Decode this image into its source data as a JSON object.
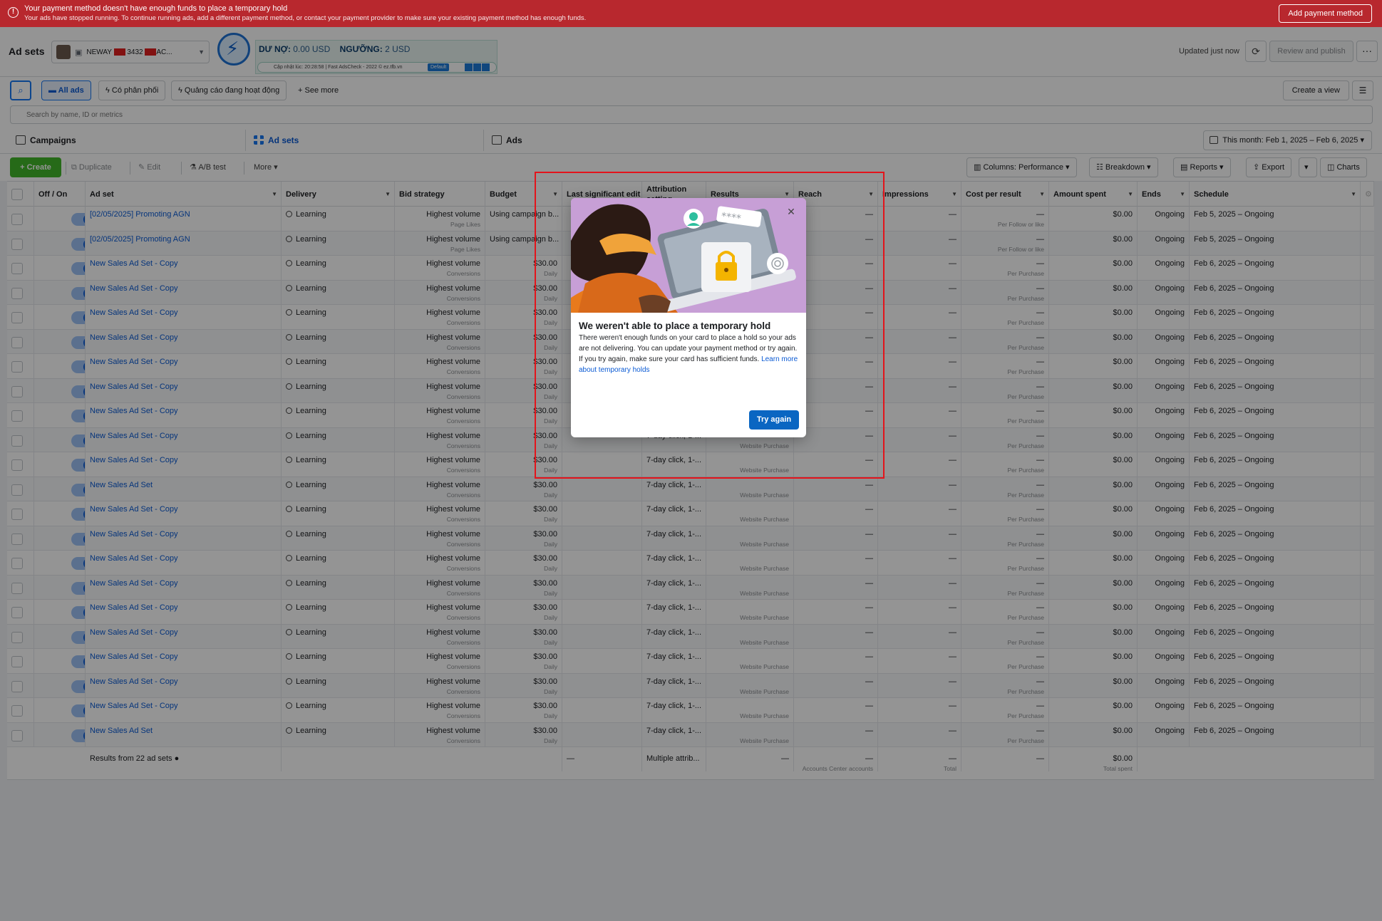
{
  "banner": {
    "title": "Your payment method doesn't have enough funds to place a temporary hold",
    "subtitle": "Your ads have stopped running. To continue running ads, add a different payment method, or contact your payment provider to make sure your existing payment method has enough funds.",
    "button": "Add payment method"
  },
  "header": {
    "title": "Ad sets",
    "account_name_prefix": "NEWAY",
    "account_number": "3432",
    "account_suffix": "AC...",
    "updated": "Updated just now",
    "review_publish": "Review and publish",
    "more": "···"
  },
  "extension": {
    "debt_label": "DƯ NỢ:",
    "debt_value": "0.00 USD",
    "threshold_label": "NGƯỠNG:",
    "threshold_value": "2 USD",
    "update_line": "Cập nhật lúc: 20:28:58 | Fast AdsCheck - 2022 © ez.tfb.vn",
    "default_tag": "Default"
  },
  "filters": {
    "all_ads": "All ads",
    "delivered": "Có phân phối",
    "active_ads": "Quảng cáo đang hoạt động",
    "see_more": "See more",
    "create_view": "Create a view",
    "search_placeholder": "Search by name, ID or metrics"
  },
  "tabs": {
    "campaigns": "Campaigns",
    "adsets": "Ad sets",
    "ads": "Ads",
    "date_range": "This month: Feb 1, 2025 – Feb 6, 2025"
  },
  "toolbar": {
    "create": "+ Create",
    "duplicate": "Duplicate",
    "edit": "Edit",
    "ab_test": "A/B test",
    "more": "More",
    "columns": "Columns: Performance",
    "breakdown": "Breakdown",
    "reports": "Reports",
    "export": "Export",
    "charts": "Charts"
  },
  "columns": {
    "offon": "Off / On",
    "adset": "Ad set",
    "delivery": "Delivery",
    "bid": "Bid strategy",
    "budget": "Budget",
    "last_edit": "Last significant edit",
    "attribution": "Attribution setting",
    "results": "Results",
    "reach": "Reach",
    "impressions": "Impressions",
    "cpr": "Cost per result",
    "spent": "Amount spent",
    "ends": "Ends",
    "schedule": "Schedule"
  },
  "rows": [
    {
      "name": "[02/05/2025] Promoting AGN",
      "delivery": "Learning",
      "bid": "Highest volume",
      "bid_sub": "Page Likes",
      "budget": "Using campaign b...",
      "budget_sub": "",
      "attr": "",
      "result_sub": "",
      "reach": "—",
      "impr": "—",
      "cpr": "—",
      "cpr_sub": "Per Follow or like",
      "spent": "$0.00",
      "ends": "Ongoing",
      "schedule": "Feb 5, 2025 – Ongoing"
    },
    {
      "name": "[02/05/2025] Promoting AGN",
      "delivery": "Learning",
      "bid": "Highest volume",
      "bid_sub": "Page Likes",
      "budget": "Using campaign b...",
      "budget_sub": "",
      "attr": "",
      "result_sub": "",
      "reach": "—",
      "impr": "—",
      "cpr": "—",
      "cpr_sub": "Per Follow or like",
      "spent": "$0.00",
      "ends": "Ongoing",
      "schedule": "Feb 5, 2025 – Ongoing"
    },
    {
      "name": "New Sales Ad Set - Copy",
      "delivery": "Learning",
      "bid": "Highest volume",
      "bid_sub": "Conversions",
      "budget": "$30.00",
      "budget_sub": "Daily",
      "attr": "",
      "result_sub": "",
      "reach": "—",
      "impr": "—",
      "cpr": "—",
      "cpr_sub": "Per Purchase",
      "spent": "$0.00",
      "ends": "Ongoing",
      "schedule": "Feb 6, 2025 – Ongoing"
    },
    {
      "name": "New Sales Ad Set - Copy",
      "delivery": "Learning",
      "bid": "Highest volume",
      "bid_sub": "Conversions",
      "budget": "$30.00",
      "budget_sub": "Daily",
      "attr": "",
      "result_sub": "",
      "reach": "—",
      "impr": "—",
      "cpr": "—",
      "cpr_sub": "Per Purchase",
      "spent": "$0.00",
      "ends": "Ongoing",
      "schedule": "Feb 6, 2025 – Ongoing"
    },
    {
      "name": "New Sales Ad Set - Copy",
      "delivery": "Learning",
      "bid": "Highest volume",
      "bid_sub": "Conversions",
      "budget": "$30.00",
      "budget_sub": "Daily",
      "attr": "",
      "result_sub": "",
      "reach": "—",
      "impr": "—",
      "cpr": "—",
      "cpr_sub": "Per Purchase",
      "spent": "$0.00",
      "ends": "Ongoing",
      "schedule": "Feb 6, 2025 – Ongoing"
    },
    {
      "name": "New Sales Ad Set - Copy",
      "delivery": "Learning",
      "bid": "Highest volume",
      "bid_sub": "Conversions",
      "budget": "$30.00",
      "budget_sub": "Daily",
      "attr": "",
      "result_sub": "",
      "reach": "—",
      "impr": "—",
      "cpr": "—",
      "cpr_sub": "Per Purchase",
      "spent": "$0.00",
      "ends": "Ongoing",
      "schedule": "Feb 6, 2025 – Ongoing"
    },
    {
      "name": "New Sales Ad Set - Copy",
      "delivery": "Learning",
      "bid": "Highest volume",
      "bid_sub": "Conversions",
      "budget": "$30.00",
      "budget_sub": "Daily",
      "attr": "",
      "result_sub": "",
      "reach": "—",
      "impr": "—",
      "cpr": "—",
      "cpr_sub": "Per Purchase",
      "spent": "$0.00",
      "ends": "Ongoing",
      "schedule": "Feb 6, 2025 – Ongoing"
    },
    {
      "name": "New Sales Ad Set - Copy",
      "delivery": "Learning",
      "bid": "Highest volume",
      "bid_sub": "Conversions",
      "budget": "$30.00",
      "budget_sub": "Daily",
      "attr": "",
      "result_sub": "",
      "reach": "—",
      "impr": "—",
      "cpr": "—",
      "cpr_sub": "Per Purchase",
      "spent": "$0.00",
      "ends": "Ongoing",
      "schedule": "Feb 6, 2025 – Ongoing"
    },
    {
      "name": "New Sales Ad Set - Copy",
      "delivery": "Learning",
      "bid": "Highest volume",
      "bid_sub": "Conversions",
      "budget": "$30.00",
      "budget_sub": "Daily",
      "attr": "",
      "result_sub": "",
      "reach": "—",
      "impr": "—",
      "cpr": "—",
      "cpr_sub": "Per Purchase",
      "spent": "$0.00",
      "ends": "Ongoing",
      "schedule": "Feb 6, 2025 – Ongoing"
    },
    {
      "name": "New Sales Ad Set - Copy",
      "delivery": "Learning",
      "bid": "Highest volume",
      "bid_sub": "Conversions",
      "budget": "$30.00",
      "budget_sub": "Daily",
      "attr": "7-day click, 1-...",
      "result_sub": "Website Purchase",
      "reach": "—",
      "impr": "—",
      "cpr": "—",
      "cpr_sub": "Per Purchase",
      "spent": "$0.00",
      "ends": "Ongoing",
      "schedule": "Feb 6, 2025 – Ongoing"
    },
    {
      "name": "New Sales Ad Set - Copy",
      "delivery": "Learning",
      "bid": "Highest volume",
      "bid_sub": "Conversions",
      "budget": "$30.00",
      "budget_sub": "Daily",
      "attr": "7-day click, 1-...",
      "result_sub": "Website Purchase",
      "reach": "—",
      "impr": "—",
      "cpr": "—",
      "cpr_sub": "Per Purchase",
      "spent": "$0.00",
      "ends": "Ongoing",
      "schedule": "Feb 6, 2025 – Ongoing"
    },
    {
      "name": "New Sales Ad Set",
      "delivery": "Learning",
      "bid": "Highest volume",
      "bid_sub": "Conversions",
      "budget": "$30.00",
      "budget_sub": "Daily",
      "attr": "7-day click, 1-...",
      "result_sub": "Website Purchase",
      "reach": "—",
      "impr": "—",
      "cpr": "—",
      "cpr_sub": "Per Purchase",
      "spent": "$0.00",
      "ends": "Ongoing",
      "schedule": "Feb 6, 2025 – Ongoing"
    },
    {
      "name": "New Sales Ad Set - Copy",
      "delivery": "Learning",
      "bid": "Highest volume",
      "bid_sub": "Conversions",
      "budget": "$30.00",
      "budget_sub": "Daily",
      "attr": "7-day click, 1-...",
      "result_sub": "Website Purchase",
      "reach": "—",
      "impr": "—",
      "cpr": "—",
      "cpr_sub": "Per Purchase",
      "spent": "$0.00",
      "ends": "Ongoing",
      "schedule": "Feb 6, 2025 – Ongoing"
    },
    {
      "name": "New Sales Ad Set - Copy",
      "delivery": "Learning",
      "bid": "Highest volume",
      "bid_sub": "Conversions",
      "budget": "$30.00",
      "budget_sub": "Daily",
      "attr": "7-day click, 1-...",
      "result_sub": "Website Purchase",
      "reach": "—",
      "impr": "—",
      "cpr": "—",
      "cpr_sub": "Per Purchase",
      "spent": "$0.00",
      "ends": "Ongoing",
      "schedule": "Feb 6, 2025 – Ongoing"
    },
    {
      "name": "New Sales Ad Set - Copy",
      "delivery": "Learning",
      "bid": "Highest volume",
      "bid_sub": "Conversions",
      "budget": "$30.00",
      "budget_sub": "Daily",
      "attr": "7-day click, 1-...",
      "result_sub": "Website Purchase",
      "reach": "—",
      "impr": "—",
      "cpr": "—",
      "cpr_sub": "Per Purchase",
      "spent": "$0.00",
      "ends": "Ongoing",
      "schedule": "Feb 6, 2025 – Ongoing"
    },
    {
      "name": "New Sales Ad Set - Copy",
      "delivery": "Learning",
      "bid": "Highest volume",
      "bid_sub": "Conversions",
      "budget": "$30.00",
      "budget_sub": "Daily",
      "attr": "7-day click, 1-...",
      "result_sub": "Website Purchase",
      "reach": "—",
      "impr": "—",
      "cpr": "—",
      "cpr_sub": "Per Purchase",
      "spent": "$0.00",
      "ends": "Ongoing",
      "schedule": "Feb 6, 2025 – Ongoing"
    },
    {
      "name": "New Sales Ad Set - Copy",
      "delivery": "Learning",
      "bid": "Highest volume",
      "bid_sub": "Conversions",
      "budget": "$30.00",
      "budget_sub": "Daily",
      "attr": "7-day click, 1-...",
      "result_sub": "Website Purchase",
      "reach": "—",
      "impr": "—",
      "cpr": "—",
      "cpr_sub": "Per Purchase",
      "spent": "$0.00",
      "ends": "Ongoing",
      "schedule": "Feb 6, 2025 – Ongoing"
    },
    {
      "name": "New Sales Ad Set - Copy",
      "delivery": "Learning",
      "bid": "Highest volume",
      "bid_sub": "Conversions",
      "budget": "$30.00",
      "budget_sub": "Daily",
      "attr": "7-day click, 1-...",
      "result_sub": "Website Purchase",
      "reach": "—",
      "impr": "—",
      "cpr": "—",
      "cpr_sub": "Per Purchase",
      "spent": "$0.00",
      "ends": "Ongoing",
      "schedule": "Feb 6, 2025 – Ongoing"
    },
    {
      "name": "New Sales Ad Set - Copy",
      "delivery": "Learning",
      "bid": "Highest volume",
      "bid_sub": "Conversions",
      "budget": "$30.00",
      "budget_sub": "Daily",
      "attr": "7-day click, 1-...",
      "result_sub": "Website Purchase",
      "reach": "—",
      "impr": "—",
      "cpr": "—",
      "cpr_sub": "Per Purchase",
      "spent": "$0.00",
      "ends": "Ongoing",
      "schedule": "Feb 6, 2025 – Ongoing"
    },
    {
      "name": "New Sales Ad Set - Copy",
      "delivery": "Learning",
      "bid": "Highest volume",
      "bid_sub": "Conversions",
      "budget": "$30.00",
      "budget_sub": "Daily",
      "attr": "7-day click, 1-...",
      "result_sub": "Website Purchase",
      "reach": "—",
      "impr": "—",
      "cpr": "—",
      "cpr_sub": "Per Purchase",
      "spent": "$0.00",
      "ends": "Ongoing",
      "schedule": "Feb 6, 2025 – Ongoing"
    },
    {
      "name": "New Sales Ad Set - Copy",
      "delivery": "Learning",
      "bid": "Highest volume",
      "bid_sub": "Conversions",
      "budget": "$30.00",
      "budget_sub": "Daily",
      "attr": "7-day click, 1-...",
      "result_sub": "Website Purchase",
      "reach": "—",
      "impr": "—",
      "cpr": "—",
      "cpr_sub": "Per Purchase",
      "spent": "$0.00",
      "ends": "Ongoing",
      "schedule": "Feb 6, 2025 – Ongoing"
    },
    {
      "name": "New Sales Ad Set",
      "delivery": "Learning",
      "bid": "Highest volume",
      "bid_sub": "Conversions",
      "budget": "$30.00",
      "budget_sub": "Daily",
      "attr": "7-day click, 1-...",
      "result_sub": "Website Purchase",
      "reach": "—",
      "impr": "—",
      "cpr": "—",
      "cpr_sub": "Per Purchase",
      "spent": "$0.00",
      "ends": "Ongoing",
      "schedule": "Feb 6, 2025 – Ongoing"
    }
  ],
  "summary": {
    "results_from": "Results from 22 ad sets",
    "last_edit": "—",
    "attribution": "Multiple attrib...",
    "results": "—",
    "reach": "—",
    "reach_sub": "Accounts Center accounts",
    "impressions": "—",
    "impressions_sub": "Total",
    "cpr": "—",
    "spent": "$0.00",
    "spent_sub": "Total spent"
  },
  "modal": {
    "title": "We weren't able to place a temporary hold",
    "body": "There weren't enough funds on your card to place a hold so your ads are not delivering. You can update your payment method or try again. If you try again, make sure your card has sufficient funds.",
    "link": "Learn more about temporary holds",
    "button": "Try again",
    "password_mask": "****"
  },
  "colors": {
    "banner": "#b8282e",
    "accent": "#1877f2",
    "create": "#42b72a",
    "highlight": "#e3141b"
  }
}
